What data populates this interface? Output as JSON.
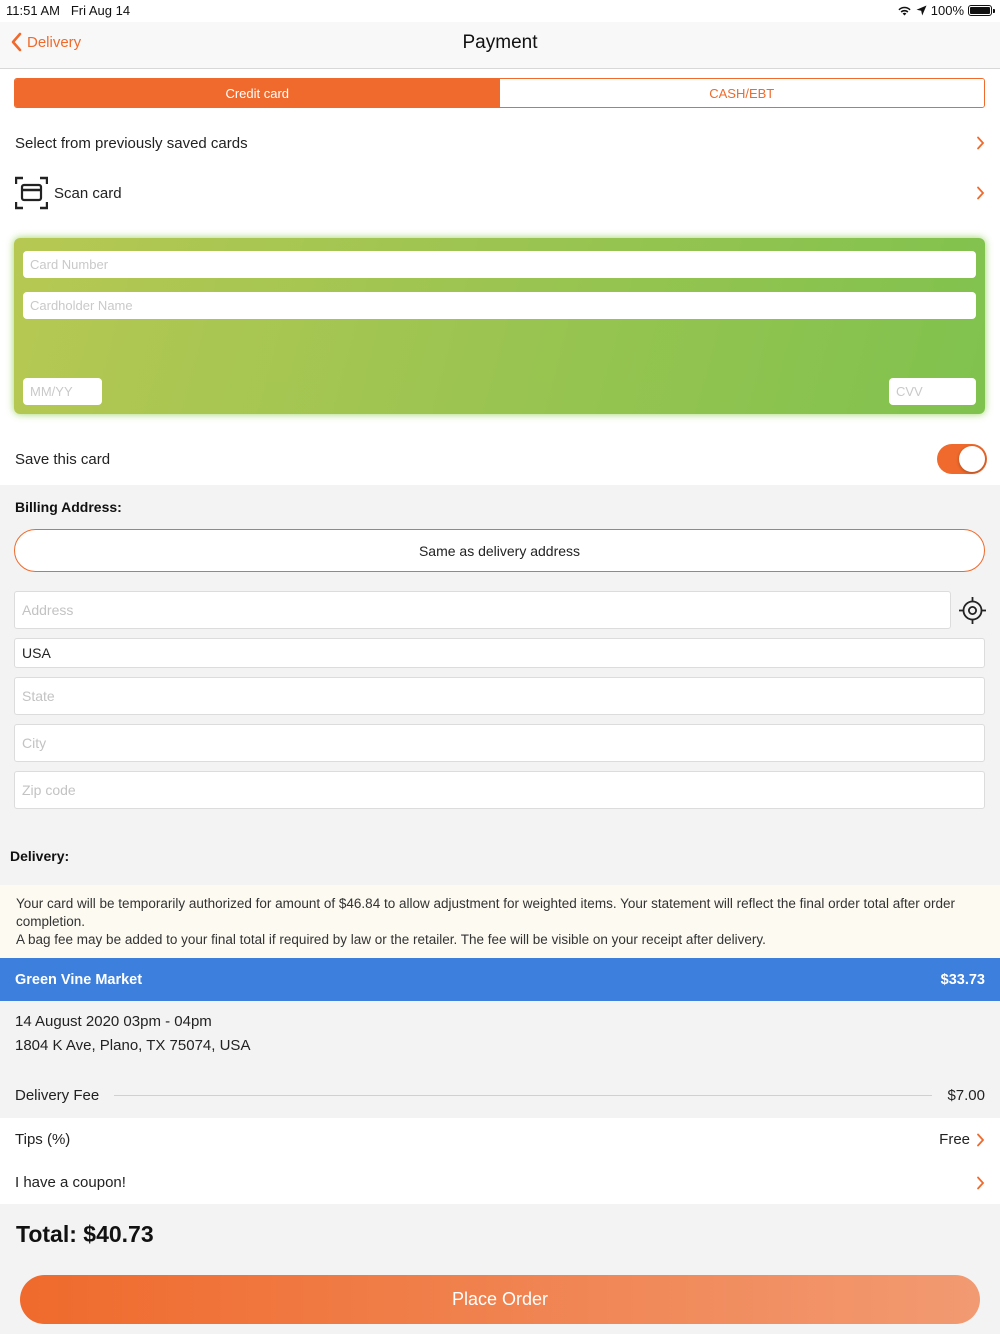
{
  "status_bar": {
    "time": "11:51 AM",
    "date": "Fri Aug 14",
    "battery": "100%"
  },
  "nav": {
    "back_label": "Delivery",
    "title": "Payment"
  },
  "payment_tabs": [
    {
      "label": "Credit card",
      "active": true
    },
    {
      "label": "CASH/EBT",
      "active": false
    }
  ],
  "saved_cards": {
    "label": "Select from previously saved cards"
  },
  "scan_card": {
    "label": "Scan card"
  },
  "card_form": {
    "card_number_placeholder": "Card Number",
    "cardholder_placeholder": "Cardholder Name",
    "expiry_placeholder": "MM/YY",
    "cvv_placeholder": "CVV"
  },
  "save_card": {
    "label": "Save this card",
    "enabled": true
  },
  "billing": {
    "title": "Billing Address:",
    "same_as_delivery_label": "Same as delivery address",
    "address_placeholder": "Address",
    "country_value": "USA",
    "state_placeholder": "State",
    "city_placeholder": "City",
    "zip_placeholder": "Zip code"
  },
  "delivery": {
    "title": "Delivery:",
    "notice_line1": "Your card will be temporarily authorized for amount of $46.84 to allow adjustment for weighted items. Your statement will reflect the final order total after order completion.",
    "notice_line2": "A bag fee may be added to your final total if required by law or the retailer. The fee will be visible on your receipt after delivery.",
    "store_name": "Green Vine Market",
    "store_total": "$33.73",
    "time_slot": "14 August 2020 03pm - 04pm",
    "address": "1804 K Ave, Plano, TX 75074, USA",
    "fee_label": "Delivery Fee",
    "fee_value": "$7.00",
    "tips_label": "Tips (%)",
    "tips_value": "Free",
    "coupon_label": "I have a coupon!"
  },
  "total": {
    "label": "Total: $40.73"
  },
  "place_order": {
    "label": "Place Order"
  },
  "colors": {
    "accent": "#ef6a2c",
    "store_bar": "#3d7fdc",
    "card_green": "#9bc451"
  }
}
